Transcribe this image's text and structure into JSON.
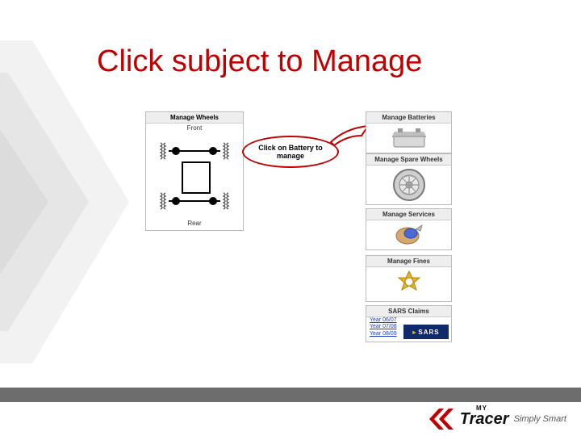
{
  "title": "Click subject to Manage",
  "wheels_panel": {
    "header": "Manage Wheels",
    "front_label": "Front",
    "rear_label": "Rear"
  },
  "callout": {
    "text": "Click on Battery to manage"
  },
  "cards": {
    "batteries": "Manage Batteries",
    "spare": "Manage Spare Wheels",
    "services": "Manage Services",
    "fines": "Manage Fines",
    "sars": "SARS Claims"
  },
  "sars": {
    "links": [
      "Year 06/07",
      "Year 07/08",
      "Year 08/09"
    ],
    "logo_text": "SARS"
  },
  "brand": {
    "my": "MY",
    "name": "Tracer",
    "tagline": "Simply Smart"
  }
}
